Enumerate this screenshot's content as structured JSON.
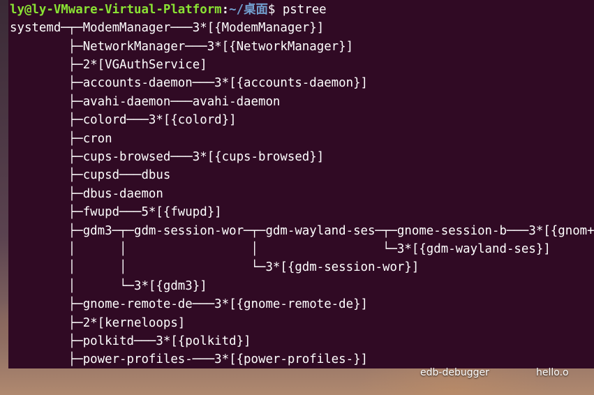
{
  "terminal": {
    "prompt": {
      "user_host": "ly@ly-VMware-Virtual-Platform",
      "separator": ":",
      "path": "~/桌面",
      "symbol": "$ ",
      "command": "pstree"
    },
    "output_lines": [
      "systemd─┬─ModemManager───3*[{ModemManager}]",
      "        ├─NetworkManager───3*[{NetworkManager}]",
      "        ├─2*[VGAuthService]",
      "        ├─accounts-daemon───3*[{accounts-daemon}]",
      "        ├─avahi-daemon───avahi-daemon",
      "        ├─colord───3*[{colord}]",
      "        ├─cron",
      "        ├─cups-browsed───3*[{cups-browsed}]",
      "        ├─cupsd───dbus",
      "        ├─dbus-daemon",
      "        ├─fwupd───5*[{fwupd}]",
      "        ├─gdm3─┬─gdm-session-wor─┬─gdm-wayland-ses─┬─gnome-session-b───3*[{gnom+",
      "        │      │                 │                 └─3*[{gdm-wayland-ses}]",
      "        │      │                 └─3*[{gdm-session-wor}]",
      "        │      └─3*[{gdm3}]",
      "        ├─gnome-remote-de───3*[{gnome-remote-de}]",
      "        ├─2*[kerneloops]",
      "        ├─polkitd───3*[{polkitd}]",
      "        ├─power-profiles-───3*[{power-profiles-}]"
    ]
  },
  "desktop": {
    "icons": [
      {
        "label": "edb-debugger"
      },
      {
        "label": "hello.o"
      }
    ]
  }
}
